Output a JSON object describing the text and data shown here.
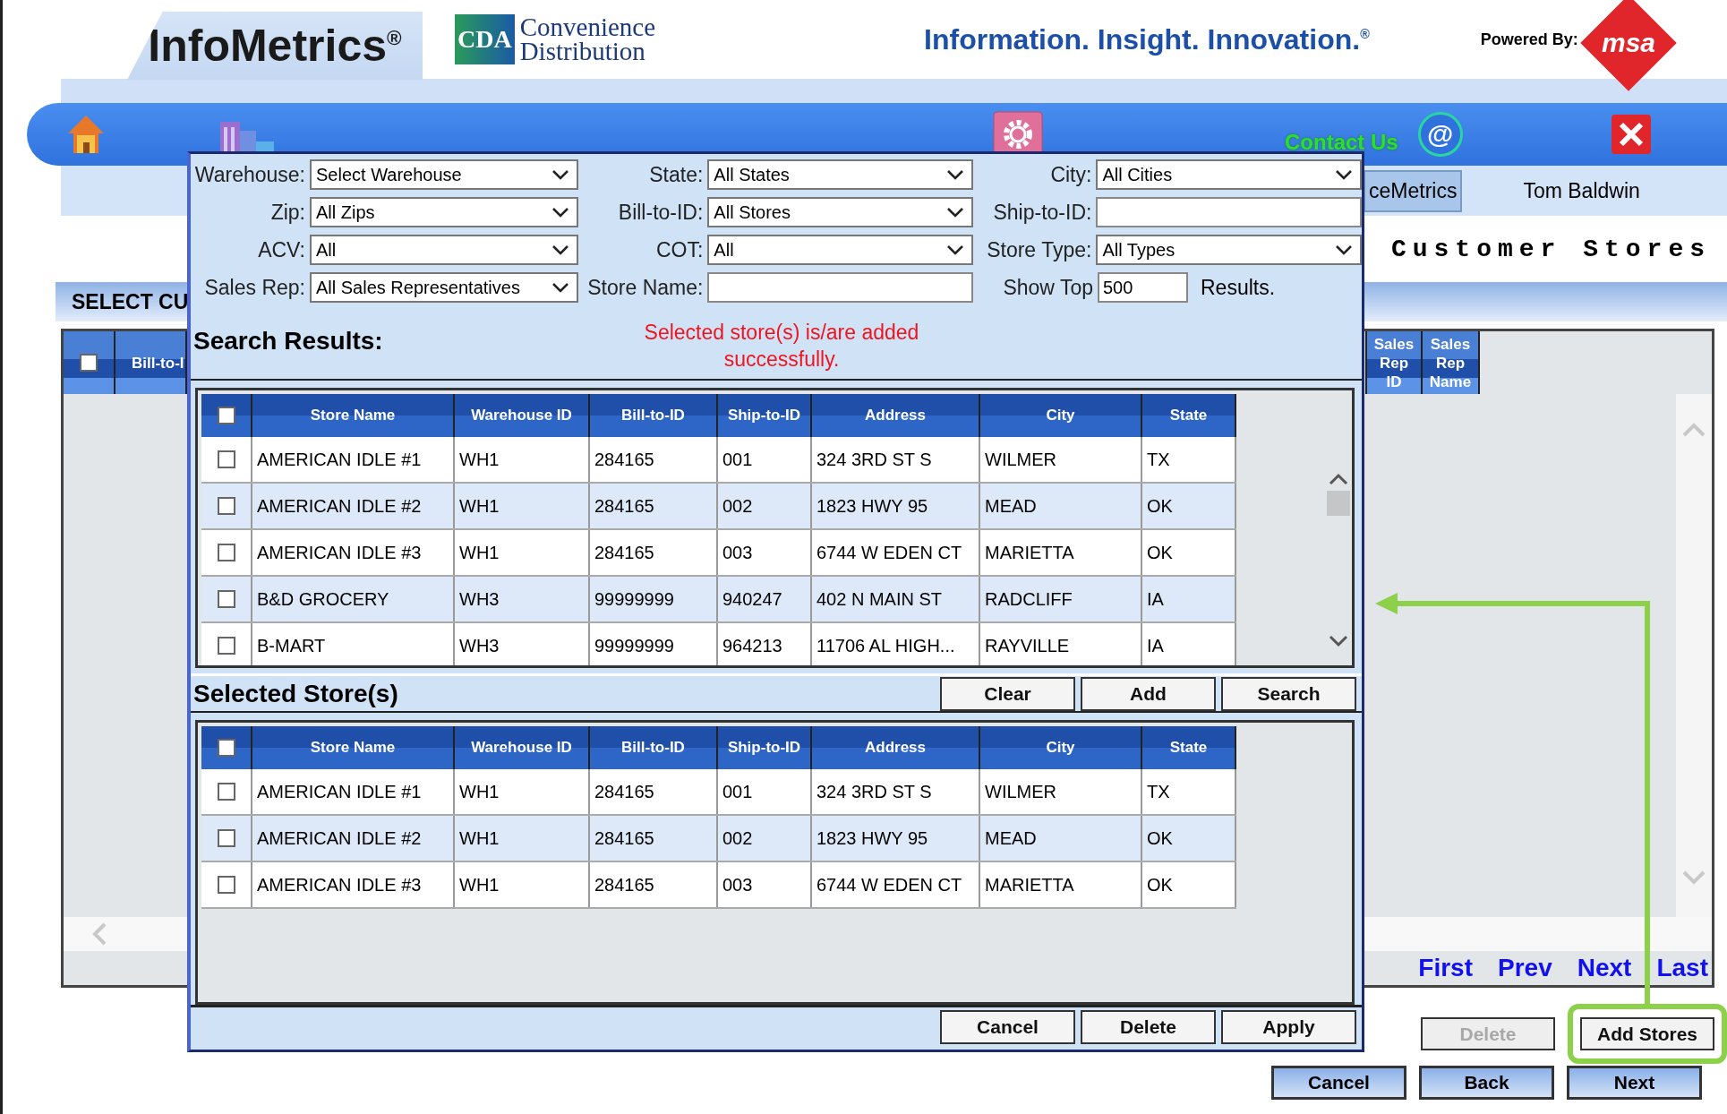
{
  "header": {
    "logo": "InfoMetrics",
    "logo_mark": "®",
    "partner_badge": "CDA",
    "partner_lines": [
      "Convenience",
      "Distribution"
    ],
    "tagline": "Information. Insight. Innovation.",
    "tagline_mark": "®",
    "powered_by": "Powered By:",
    "brand_logo": "msa"
  },
  "nav": {
    "contact": "Contact Us",
    "contact_icon": "@"
  },
  "user_bar": {
    "tab": "ceMetrics",
    "user": "Tom Baldwin"
  },
  "page_title": "Customer Stores",
  "section_title": "SELECT CU",
  "store_table": {
    "select_all": false,
    "columns": [
      "Bill-to-I",
      "Sales Rep ID",
      "Sales Rep Name"
    ]
  },
  "pagination": [
    "First",
    "Prev",
    "Next",
    "Last"
  ],
  "actions": [
    {
      "label": "Delete",
      "disabled": true,
      "highlighted": false
    },
    {
      "label": "Add Stores",
      "disabled": false,
      "highlighted": true
    }
  ],
  "wizard_buttons": [
    "Cancel",
    "Back",
    "Next"
  ],
  "dialog": {
    "filters": [
      {
        "label": "Warehouse:",
        "kind": "select",
        "value": "Select Warehouse"
      },
      {
        "label": "State:",
        "kind": "select",
        "value": "All States"
      },
      {
        "label": "City:",
        "kind": "select",
        "value": "All Cities"
      },
      {
        "label": "Zip:",
        "kind": "select",
        "value": "All Zips"
      },
      {
        "label": "Bill-to-ID:",
        "kind": "select",
        "value": "All Stores"
      },
      {
        "label": "Ship-to-ID:",
        "kind": "input"
      },
      {
        "label": "ACV:",
        "kind": "select",
        "value": "All"
      },
      {
        "label": "COT:",
        "kind": "select",
        "value": "All"
      },
      {
        "label": "Store Type:",
        "kind": "select",
        "value": "All Types"
      },
      {
        "label": "Sales Rep:",
        "kind": "select",
        "value": "All Sales Representatives"
      },
      {
        "label": "Store Name:",
        "kind": "input"
      },
      {
        "label": "Show Top",
        "kind": "number",
        "value": "500",
        "suffix": "Results."
      }
    ],
    "search_results": {
      "title": "Search Results:",
      "message": "Selected store(s) is/are added successfully.",
      "select_all": false,
      "columns": [
        "Store Name",
        "Warehouse ID",
        "Bill-to-ID",
        "Ship-to-ID",
        "Address",
        "City",
        "State"
      ],
      "rows": [
        {
          "checked": false,
          "cells": [
            "AMERICAN IDLE #1",
            "WH1",
            "284165",
            "001",
            "324 3RD ST S",
            "WILMER",
            "TX"
          ]
        },
        {
          "checked": false,
          "cells": [
            "AMERICAN IDLE #2",
            "WH1",
            "284165",
            "002",
            "1823 HWY 95",
            "MEAD",
            "OK"
          ]
        },
        {
          "checked": false,
          "cells": [
            "AMERICAN IDLE #3",
            "WH1",
            "284165",
            "003",
            "6744 W EDEN CT",
            "MARIETTA",
            "OK"
          ]
        },
        {
          "checked": false,
          "cells": [
            "B&D GROCERY",
            "WH3",
            "99999999",
            "940247",
            "402 N MAIN ST",
            "RADCLIFF",
            "IA"
          ]
        },
        {
          "checked": false,
          "cells": [
            "B-MART",
            "WH3",
            "99999999",
            "964213",
            "11706 AL HIGH...",
            "RAYVILLE",
            "IA"
          ]
        }
      ]
    },
    "selected": {
      "title": "Selected Store(s)",
      "buttons": [
        "Clear",
        "Add",
        "Search"
      ],
      "select_all": false,
      "columns": [
        "Store Name",
        "Warehouse ID",
        "Bill-to-ID",
        "Ship-to-ID",
        "Address",
        "City",
        "State"
      ],
      "rows": [
        {
          "checked": false,
          "cells": [
            "AMERICAN IDLE #1",
            "WH1",
            "284165",
            "001",
            "324 3RD ST S",
            "WILMER",
            "TX"
          ]
        },
        {
          "checked": false,
          "cells": [
            "AMERICAN IDLE #2",
            "WH1",
            "284165",
            "002",
            "1823 HWY 95",
            "MEAD",
            "OK"
          ]
        },
        {
          "checked": false,
          "cells": [
            "AMERICAN IDLE #3",
            "WH1",
            "284165",
            "003",
            "6744 W EDEN CT",
            "MARIETTA",
            "OK"
          ]
        }
      ]
    },
    "buttons": [
      "Cancel",
      "Delete",
      "Apply"
    ]
  }
}
